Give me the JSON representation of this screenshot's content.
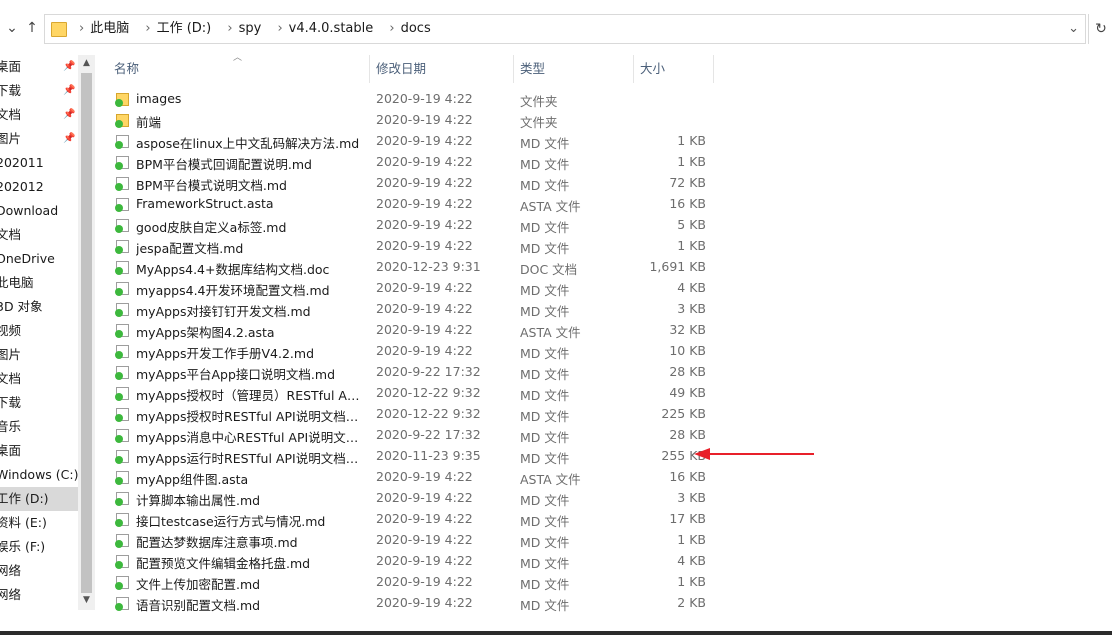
{
  "address": {
    "crumbs": [
      "此电脑",
      "工作 (D:)",
      "spy",
      "v4.4.0.stable",
      "docs"
    ]
  },
  "sidebar": {
    "items": [
      {
        "label": "桌面",
        "pinned": true
      },
      {
        "label": "下载",
        "pinned": true
      },
      {
        "label": "文档",
        "pinned": true
      },
      {
        "label": "图片",
        "pinned": true
      },
      {
        "label": "202011",
        "pinned": false
      },
      {
        "label": "202012",
        "pinned": false
      },
      {
        "label": "Download",
        "pinned": false
      },
      {
        "label": "文档",
        "pinned": false
      },
      {
        "label": "OneDrive",
        "pinned": false
      },
      {
        "label": "此电脑",
        "pinned": false
      },
      {
        "label": "3D 对象",
        "pinned": false
      },
      {
        "label": "视频",
        "pinned": false
      },
      {
        "label": "图片",
        "pinned": false
      },
      {
        "label": "文档",
        "pinned": false
      },
      {
        "label": "下载",
        "pinned": false
      },
      {
        "label": "音乐",
        "pinned": false
      },
      {
        "label": "桌面",
        "pinned": false
      },
      {
        "label": "Windows (C:)",
        "pinned": false
      },
      {
        "label": "工作 (D:)",
        "pinned": false,
        "selected": true
      },
      {
        "label": "资料 (E:)",
        "pinned": false
      },
      {
        "label": "娱乐 (F:)",
        "pinned": false
      },
      {
        "label": "网络",
        "pinned": false
      },
      {
        "label": "网络",
        "pinned": false
      }
    ]
  },
  "columns": {
    "name": "名称",
    "date": "修改日期",
    "type": "类型",
    "size": "大小"
  },
  "files": [
    {
      "name": "images",
      "date": "2020-9-19 4:22",
      "type": "文件夹",
      "size": "",
      "kind": "folder"
    },
    {
      "name": "前端",
      "date": "2020-9-19 4:22",
      "type": "文件夹",
      "size": "",
      "kind": "folder"
    },
    {
      "name": "aspose在linux上中文乱码解决方法.md",
      "date": "2020-9-19 4:22",
      "type": "MD 文件",
      "size": "1 KB",
      "kind": "file"
    },
    {
      "name": "BPM平台模式回调配置说明.md",
      "date": "2020-9-19 4:22",
      "type": "MD 文件",
      "size": "1 KB",
      "kind": "file"
    },
    {
      "name": "BPM平台模式说明文档.md",
      "date": "2020-9-19 4:22",
      "type": "MD 文件",
      "size": "72 KB",
      "kind": "file"
    },
    {
      "name": "FrameworkStruct.asta",
      "date": "2020-9-19 4:22",
      "type": "ASTA 文件",
      "size": "16 KB",
      "kind": "file"
    },
    {
      "name": "good皮肤自定义a标签.md",
      "date": "2020-9-19 4:22",
      "type": "MD 文件",
      "size": "5 KB",
      "kind": "file"
    },
    {
      "name": "jespa配置文档.md",
      "date": "2020-9-19 4:22",
      "type": "MD 文件",
      "size": "1 KB",
      "kind": "file"
    },
    {
      "name": "MyApps4.4+数据库结构文档.doc",
      "date": "2020-12-23 9:31",
      "type": "DOC 文档",
      "size": "1,691 KB",
      "kind": "file"
    },
    {
      "name": "myapps4.4开发环境配置文档.md",
      "date": "2020-9-19 4:22",
      "type": "MD 文件",
      "size": "4 KB",
      "kind": "file"
    },
    {
      "name": "myApps对接钉钉开发文档.md",
      "date": "2020-9-19 4:22",
      "type": "MD 文件",
      "size": "3 KB",
      "kind": "file"
    },
    {
      "name": "myApps架构图4.2.asta",
      "date": "2020-9-19 4:22",
      "type": "ASTA 文件",
      "size": "32 KB",
      "kind": "file"
    },
    {
      "name": "myApps开发工作手册V4.2.md",
      "date": "2020-9-19 4:22",
      "type": "MD 文件",
      "size": "10 KB",
      "kind": "file"
    },
    {
      "name": "myApps平台App接口说明文档.md",
      "date": "2020-9-22 17:32",
      "type": "MD 文件",
      "size": "28 KB",
      "kind": "file"
    },
    {
      "name": "myApps授权时（管理员）RESTful API...",
      "date": "2020-12-22 9:32",
      "type": "MD 文件",
      "size": "49 KB",
      "kind": "file"
    },
    {
      "name": "myApps授权时RESTful API说明文档.md",
      "date": "2020-12-22 9:32",
      "type": "MD 文件",
      "size": "225 KB",
      "kind": "file"
    },
    {
      "name": "myApps消息中心RESTful API说明文档....",
      "date": "2020-9-22 17:32",
      "type": "MD 文件",
      "size": "28 KB",
      "kind": "file"
    },
    {
      "name": "myApps运行时RESTful API说明文档.md",
      "date": "2020-11-23 9:35",
      "type": "MD 文件",
      "size": "255 KB",
      "kind": "file"
    },
    {
      "name": "myApp组件图.asta",
      "date": "2020-9-19 4:22",
      "type": "ASTA 文件",
      "size": "16 KB",
      "kind": "file"
    },
    {
      "name": "计算脚本输出属性.md",
      "date": "2020-9-19 4:22",
      "type": "MD 文件",
      "size": "3 KB",
      "kind": "file"
    },
    {
      "name": "接口testcase运行方式与情况.md",
      "date": "2020-9-19 4:22",
      "type": "MD 文件",
      "size": "17 KB",
      "kind": "file"
    },
    {
      "name": "配置达梦数据库注意事项.md",
      "date": "2020-9-19 4:22",
      "type": "MD 文件",
      "size": "1 KB",
      "kind": "file"
    },
    {
      "name": "配置预览文件编辑金格托盘.md",
      "date": "2020-9-19 4:22",
      "type": "MD 文件",
      "size": "4 KB",
      "kind": "file"
    },
    {
      "name": "文件上传加密配置.md",
      "date": "2020-9-19 4:22",
      "type": "MD 文件",
      "size": "1 KB",
      "kind": "file"
    },
    {
      "name": "语音识别配置文档.md",
      "date": "2020-9-19 4:22",
      "type": "MD 文件",
      "size": "2 KB",
      "kind": "file"
    }
  ],
  "colors": {
    "annotation_arrow": "#e8202a",
    "sync_badge": "#3db83d",
    "header_text": "#4c607a"
  }
}
